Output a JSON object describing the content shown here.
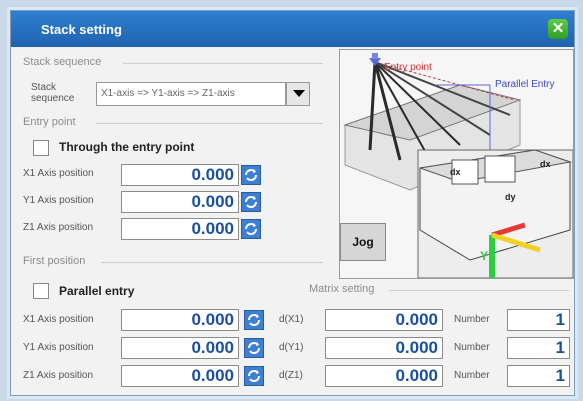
{
  "window": {
    "title": "Stack setting",
    "close_symbol": "✕"
  },
  "stack": {
    "section_title": "Stack sequence",
    "label_line1": "Stack",
    "label_line2": "sequence",
    "selected": "X1-axis => Y1-axis => Z1-axis"
  },
  "entry_point": {
    "section_title": "Entry point",
    "through_label": "Through the entry point",
    "rows": [
      {
        "label": "X1 Axis position",
        "value": "0.000"
      },
      {
        "label": "Y1 Axis position",
        "value": "0.000"
      },
      {
        "label": "Z1 Axis position",
        "value": "0.000"
      }
    ]
  },
  "preview": {
    "entry_point_label": "Entry point",
    "parallel_entry_label": "Parallel Entry",
    "dx_label": "dx",
    "dy_label": "dy",
    "y_axis_label": "Y"
  },
  "jog": {
    "label": "Jog"
  },
  "first_position": {
    "section_title": "First position",
    "parallel_label": "Parallel entry",
    "rows": [
      {
        "label": "X1 Axis position",
        "value": "0.000"
      },
      {
        "label": "Y1 Axis position",
        "value": "0.000"
      },
      {
        "label": "Z1 Axis position",
        "value": "0.000"
      }
    ]
  },
  "matrix": {
    "section_title": "Matrix setting",
    "rows": [
      {
        "d_label": "d(X1)",
        "d_value": "0.000",
        "number_label": "Number",
        "number": "1"
      },
      {
        "d_label": "d(Y1)",
        "d_value": "0.000",
        "number_label": "Number",
        "number": "1"
      },
      {
        "d_label": "d(Z1)",
        "d_value": "0.000",
        "number_label": "Number",
        "number": "1"
      }
    ]
  },
  "colors": {
    "titlebar": "#2f7fd0",
    "value_text": "#1b4fa0",
    "close_button": "#3fb52e",
    "refresh_icon": "#3d7fd4"
  }
}
